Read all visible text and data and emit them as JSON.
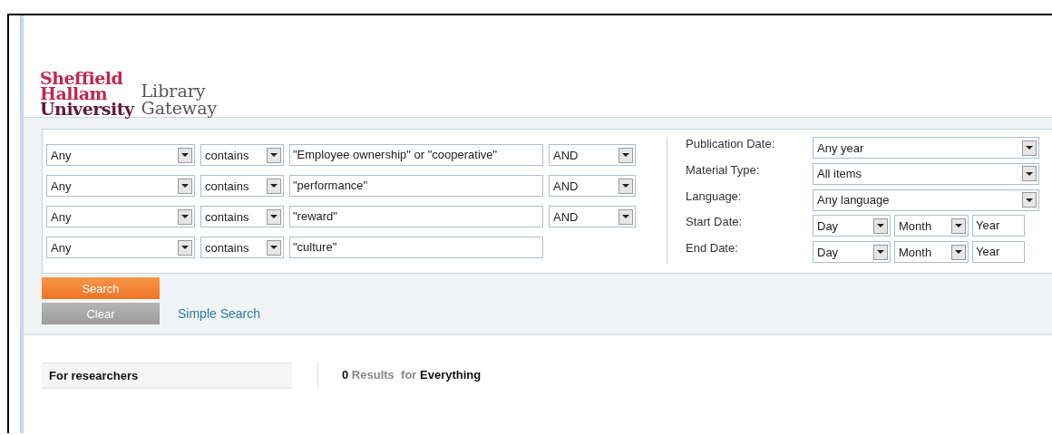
{
  "logo": {
    "university": [
      "Sheffield",
      "Hallam",
      "University"
    ],
    "product": [
      "Library",
      "Gateway"
    ]
  },
  "query_rows": [
    {
      "field": "Any",
      "operator": "contains",
      "term": "\"Employee ownership\" or \"cooperative\"",
      "boolean": "AND"
    },
    {
      "field": "Any",
      "operator": "contains",
      "term": "\"performance\"",
      "boolean": "AND"
    },
    {
      "field": "Any",
      "operator": "contains",
      "term": "\"reward\"",
      "boolean": "AND"
    },
    {
      "field": "Any",
      "operator": "contains",
      "term": "\"culture\""
    }
  ],
  "filters": [
    {
      "kind": "select",
      "label": "Publication Date:",
      "value": "Any year"
    },
    {
      "kind": "select",
      "label": "Material Type:",
      "value": "All items"
    },
    {
      "kind": "select",
      "label": "Language:",
      "value": "Any language"
    },
    {
      "kind": "date",
      "label": "Start Date:",
      "day": "Day",
      "month": "Month",
      "year": "Year"
    },
    {
      "kind": "date",
      "label": "End Date:",
      "day": "Day",
      "month": "Month",
      "year": "Year"
    }
  ],
  "buttons": {
    "search": "Search",
    "clear": "Clear",
    "simple_search": "Simple Search"
  },
  "sidebar": {
    "heading": "For researchers"
  },
  "results": {
    "count": "0",
    "label": "Results",
    "for": "for",
    "scope": "Everything"
  }
}
